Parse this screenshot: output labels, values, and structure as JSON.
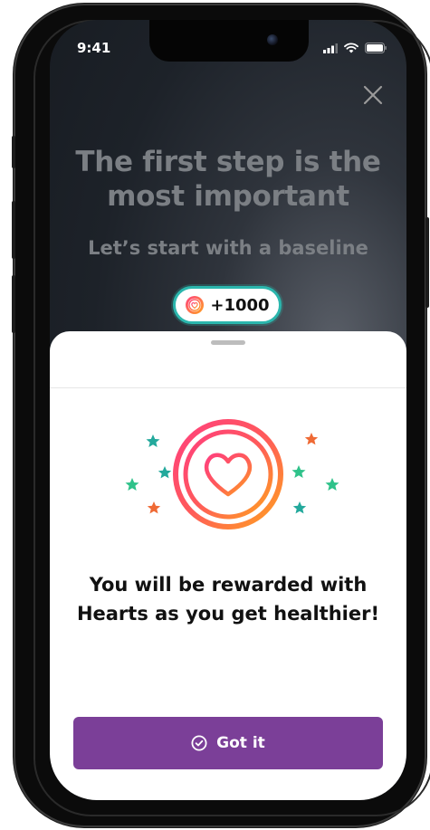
{
  "status_bar": {
    "time": "9:41"
  },
  "intro": {
    "title": "The first step is the most important",
    "subtitle": "Let’s start with a baseline"
  },
  "reward_pill": {
    "amount": "+1000"
  },
  "sheet": {
    "message": "You will be rewarded with Hearts as you get healthier!",
    "button_label": "Got it"
  },
  "colors": {
    "accent_purple": "#7b3f98",
    "pill_border": "#2bb6ad",
    "star_teal": "#23a99c",
    "star_green": "#2fc28a",
    "star_orange": "#ef6a35",
    "ring_gradient_start": "#ff3f7e",
    "ring_gradient_end": "#ffa21f"
  },
  "icons": {
    "close": "close-icon",
    "heart": "heart-icon",
    "check": "check-circle-icon"
  }
}
